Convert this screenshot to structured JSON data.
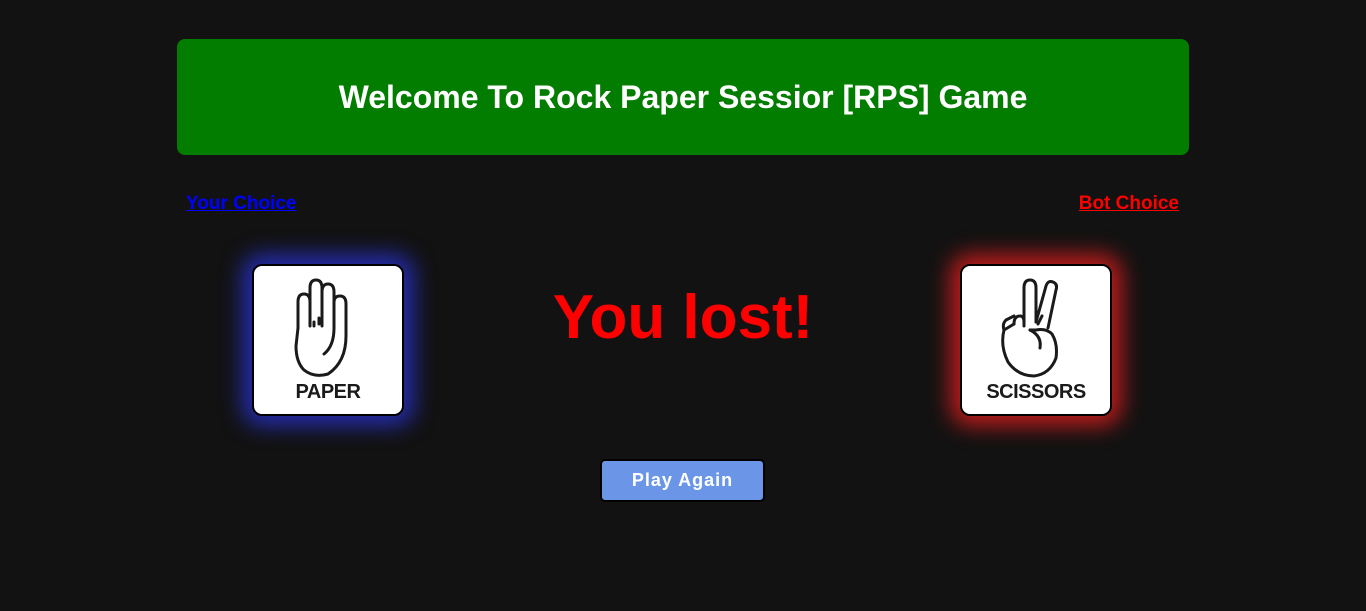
{
  "header": {
    "title": "Welcome To Rock Paper Sessior [RPS] Game"
  },
  "labels": {
    "your_choice": "Your Choice",
    "bot_choice": "Bot Choice"
  },
  "user_choice": {
    "label": "PAPER",
    "icon": "paper-hand-icon",
    "glow_color": "#2832d2"
  },
  "bot_choice": {
    "label": "SCISSORS",
    "icon": "scissors-hand-icon",
    "glow_color": "#e61e1e"
  },
  "result": {
    "message": "You lost!",
    "color": "#ff0000"
  },
  "actions": {
    "play_again": "Play Again"
  },
  "colors": {
    "header_bg": "#027d00",
    "background": "#121212",
    "button_bg": "#6b96e8"
  }
}
